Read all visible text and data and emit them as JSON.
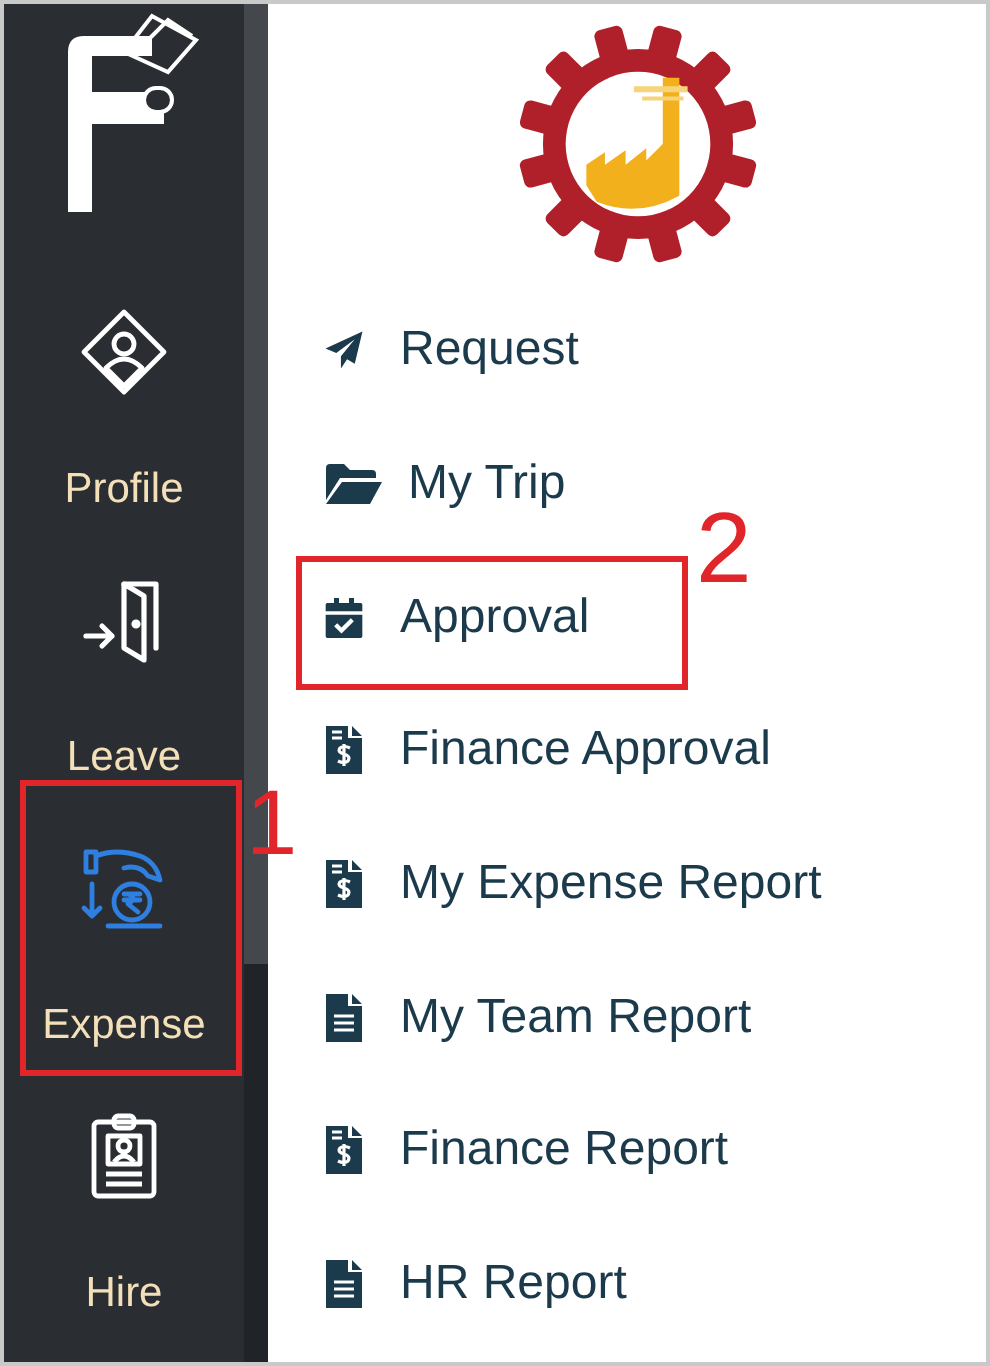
{
  "sidebar": {
    "items": [
      {
        "label": "Profile",
        "kind": "profile",
        "selected": false
      },
      {
        "label": "Leave",
        "kind": "door",
        "selected": false
      },
      {
        "label": "Expense",
        "kind": "hand-coin",
        "selected": true,
        "callout": "1"
      },
      {
        "label": "Hire",
        "kind": "badge",
        "selected": false
      }
    ]
  },
  "menu": {
    "items": [
      {
        "label": "Request",
        "kind": "plane"
      },
      {
        "label": "My Trip",
        "kind": "folder"
      },
      {
        "label": "Approval",
        "kind": "calendar-check",
        "callout": "2"
      },
      {
        "label": "Finance Approval",
        "kind": "dollar-doc"
      },
      {
        "label": "My Expense Report",
        "kind": "dollar-doc"
      },
      {
        "label": "My Team Report",
        "kind": "doc"
      },
      {
        "label": "Finance Report",
        "kind": "dollar-doc"
      },
      {
        "label": "HR Report",
        "kind": "doc"
      }
    ]
  }
}
